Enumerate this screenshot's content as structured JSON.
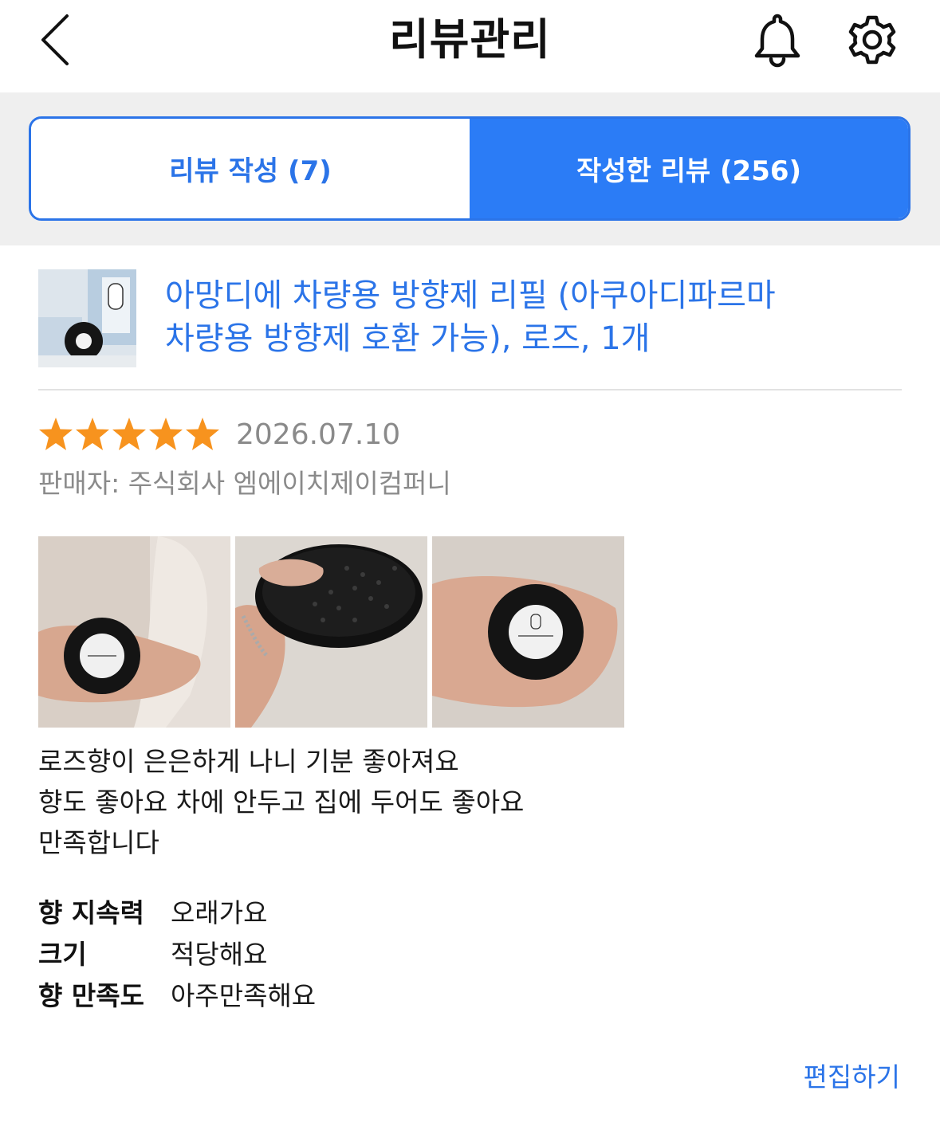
{
  "header": {
    "title": "리뷰관리"
  },
  "tabs": [
    {
      "label": "리뷰 작성 (7)",
      "active": false
    },
    {
      "label": "작성한 리뷰 (256)",
      "active": true
    }
  ],
  "product": {
    "title_line1": "아망디에 차량용 방향제 리필 (아쿠아디파르마",
    "title_line2": "차량용 방향제 호환 가능), 로즈, 1개"
  },
  "review": {
    "rating": 5,
    "rating_max": 5,
    "date": "2026.07.10",
    "seller": "판매자: 주식회사 엠에이치제이컴퍼니",
    "body_lines": [
      "로즈향이 은은하게 나니 기분 좋아져요",
      "향도 좋아요 차에 안두고 집에 두어도 좋아요",
      "만족합니다"
    ],
    "attributes": [
      {
        "label": "향 지속력",
        "value": "오래가요"
      },
      {
        "label": "크기",
        "value": "적당해요"
      },
      {
        "label": "향 만족도",
        "value": "아주만족해요"
      }
    ]
  },
  "actions": {
    "edit_label": "편집하기"
  },
  "colors": {
    "accent": "#2b74e8",
    "active_tab_bg": "#2b7cf6",
    "star": "#f7931e",
    "muted_text": "#8a8a8a"
  },
  "icons": [
    "back-icon",
    "bell-icon",
    "gear-icon",
    "star-icon"
  ]
}
